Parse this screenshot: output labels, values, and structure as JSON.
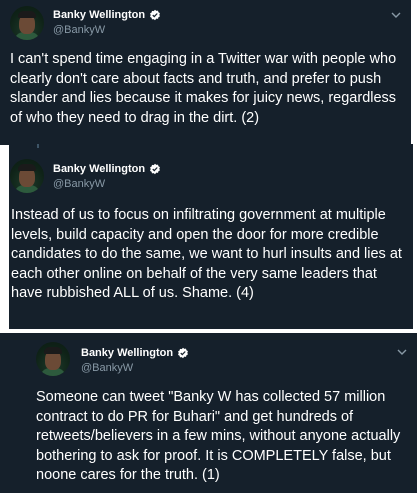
{
  "colors": {
    "card_background": "#15202b",
    "text_primary": "#ffffff",
    "text_secondary": "#8899a6",
    "verified_badge": "#ffffff"
  },
  "icons": {
    "verified": "verified-badge-icon",
    "chevron": "chevron-down-icon"
  },
  "tweets": [
    {
      "display_name": "Banky Wellington",
      "handle": "@BankyW",
      "text": "I can't spend time engaging in a Twitter war with people who clearly don't care about facts and truth, and prefer to push slander and lies because it makes for juicy news, regardless of who they need to drag in the dirt. (2)"
    },
    {
      "display_name": "Banky Wellington",
      "handle": "@BankyW",
      "text": "Instead of us to focus on infiltrating government at multiple levels, build capacity and open the door for more credible candidates to do the same, we want to hurl insults and lies at each other online on behalf of the very same leaders that have rubbished ALL of us. Shame. (4)"
    },
    {
      "display_name": "Banky Wellington",
      "handle": "@BankyW",
      "text": "Someone can tweet \"Banky W has collected 57 million contract to do PR for Buhari\" and get hundreds of retweets/believers in a few mins, without anyone actually bothering to ask for proof. It is COMPLETELY false, but noone cares for the truth. (1)"
    }
  ]
}
